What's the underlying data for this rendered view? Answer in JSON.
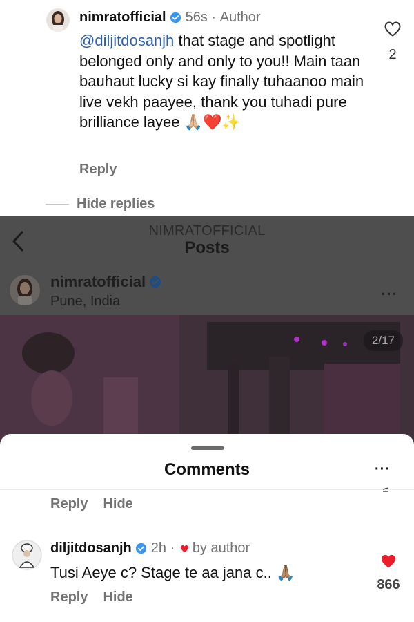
{
  "top_comment": {
    "username": "nimratofficial",
    "time": "56s",
    "separator": " · ",
    "role": "Author",
    "mention": "@diljitdosanjh",
    "text": " that stage and spotlight belonged only and only to you!! Main taan bauhaut lucky si kay finally tuhaanoo main live vekh paayee, thank you tuhadi pure brilliance layee 🙏🏼❤️✨",
    "reply_label": "Reply",
    "hide_replies_label": "Hide replies",
    "like_count": "2"
  },
  "post_screen": {
    "owner": "NIMRATOFFICIAL",
    "title": "Posts",
    "username": "nimratofficial",
    "location": "Pune, India",
    "more": "···",
    "image_counter": "2/17"
  },
  "comments_sheet": {
    "title": "Comments",
    "more": "···",
    "first_reply_label": "Reply",
    "first_hide_label": "Hide",
    "comment": {
      "username": "diljitdosanjh",
      "time": "2h",
      "separator": " · ",
      "by_author": "by author",
      "text": "Tusi Aeye c? Stage te aa jana c.. 🙏🏽",
      "reply_label": "Reply",
      "hide_label": "Hide",
      "like_count": "866"
    }
  },
  "colors": {
    "mention": "#2c5fa8",
    "verified": "#3897f0",
    "liked_heart": "#ed1d2a",
    "secondary_text": "#737373"
  },
  "icons": [
    "verified-badge-icon",
    "heart-outline-icon",
    "heart-filled-icon",
    "back-chevron-icon",
    "more-dots-icon"
  ]
}
